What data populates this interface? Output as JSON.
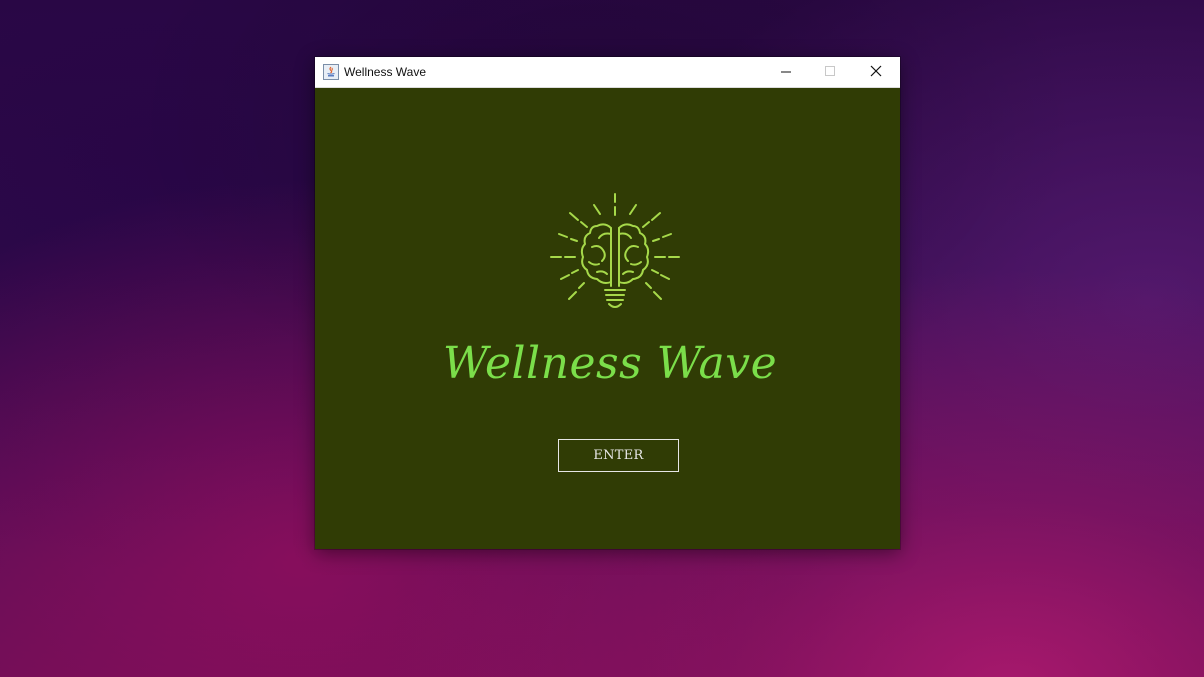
{
  "window": {
    "title": "Wellness Wave",
    "icon": "java-app-icon",
    "controls": {
      "minimize": "minimize-icon",
      "maximize": "maximize-icon",
      "close": "close-icon"
    }
  },
  "splash": {
    "logo": "brain-lightbulb-icon",
    "app_name": "Wellness Wave",
    "enter_label": "ENTER"
  },
  "colors": {
    "background": "#303c05",
    "accent": "#7bde4a",
    "button_border": "#e6e6e6"
  }
}
